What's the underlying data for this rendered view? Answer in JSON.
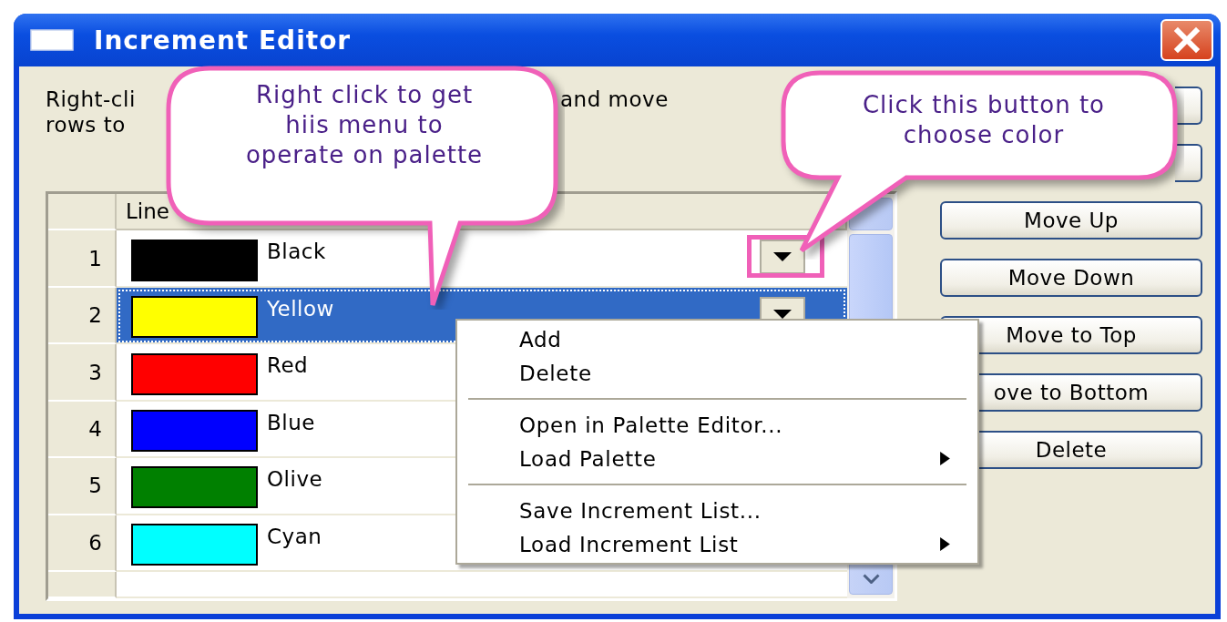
{
  "window": {
    "title": "Increment Editor"
  },
  "instruction": {
    "line_1_left": "Right-cli",
    "line_1_right": "and move",
    "line_2_left": "rows to"
  },
  "grid": {
    "column_header": "Line",
    "rows": [
      {
        "number": "1",
        "color": "#000000",
        "name": "Black",
        "selected": false,
        "color_button": true
      },
      {
        "number": "2",
        "color": "#ffff00",
        "name": "Yellow",
        "selected": true,
        "color_button": true
      },
      {
        "number": "3",
        "color": "#ff0000",
        "name": "Red",
        "selected": false,
        "color_button": false
      },
      {
        "number": "4",
        "color": "#0000ff",
        "name": "Blue",
        "selected": false,
        "color_button": false
      },
      {
        "number": "5",
        "color": "#008000",
        "name": "Olive",
        "selected": false,
        "color_button": false
      },
      {
        "number": "6",
        "color": "#00ffff",
        "name": "Cyan",
        "selected": false,
        "color_button": false
      }
    ]
  },
  "buttons": [
    {
      "kind": "covered"
    },
    {
      "kind": "covered"
    },
    {
      "kind": "labeled",
      "label": "Move Up"
    },
    {
      "kind": "labeled",
      "label": "Move Down"
    },
    {
      "kind": "labeled",
      "label": "Move to Top"
    },
    {
      "kind": "labeled",
      "label": "ove to Bottom"
    },
    {
      "kind": "labeled",
      "label": "Delete"
    }
  ],
  "context_menu": {
    "groups": [
      [
        {
          "label": "Add",
          "submenu": false
        },
        {
          "label": "Delete",
          "submenu": false
        }
      ],
      [
        {
          "label": "Open in Palette Editor...",
          "submenu": false
        },
        {
          "label": "Load Palette",
          "submenu": true
        }
      ],
      [
        {
          "label": "Save Increment List...",
          "submenu": false
        },
        {
          "label": "Load Increment List",
          "submenu": true
        }
      ]
    ]
  },
  "callouts": [
    {
      "text": "Right click to get hiis menu to operate on palette"
    },
    {
      "text": "Click this button to choose color"
    }
  ]
}
